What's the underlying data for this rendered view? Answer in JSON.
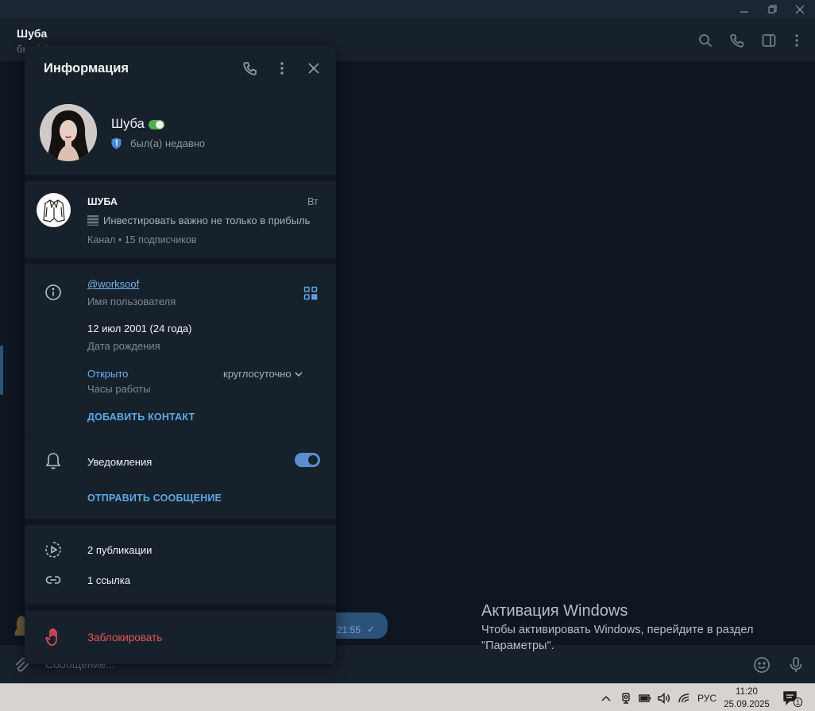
{
  "chat_header": {
    "title": "Шуба",
    "subtitle": "был(а) недавно"
  },
  "composer": {
    "placeholder": "Сообщение..."
  },
  "message": {
    "time": "21:55",
    "check": "✓"
  },
  "panel": {
    "title": "Информация",
    "profile": {
      "name": "Шуба",
      "status": "был(а) недавно"
    },
    "channel": {
      "name": "ШУБА",
      "date": "Вт",
      "preview": "Инвестировать важно не только в прибыль",
      "meta": "Канал • 15 подписчиков"
    },
    "username": {
      "value": "@worksoof",
      "label": "Имя пользователя"
    },
    "birthday": {
      "value": "12 июл 2001 (24 года)",
      "label": "Дата рождения"
    },
    "hours": {
      "status": "Открыто",
      "value": "круглосуточно",
      "label": "Часы работы"
    },
    "add_contact": "ДОБАВИТЬ КОНТАКТ",
    "notifications": {
      "label": "Уведомления",
      "enabled": true
    },
    "send_message": "ОТПРАВИТЬ СООБЩЕНИЕ",
    "posts": "2 публикации",
    "links": "1 ссылка",
    "block": "Заблокировать"
  },
  "windows_activation": {
    "title": "Активация Windows",
    "line1": "Чтобы активировать Windows, перейдите в раздел",
    "line2": "\"Параметры\"."
  },
  "taskbar": {
    "language": "РУС",
    "time": "11:20",
    "date": "25.09.2025",
    "notification_count": "1"
  },
  "colors": {
    "accent": "#5ea8e8",
    "danger": "#e5535c",
    "panel_bg": "#17212b",
    "chat_bg": "#0e1621"
  }
}
